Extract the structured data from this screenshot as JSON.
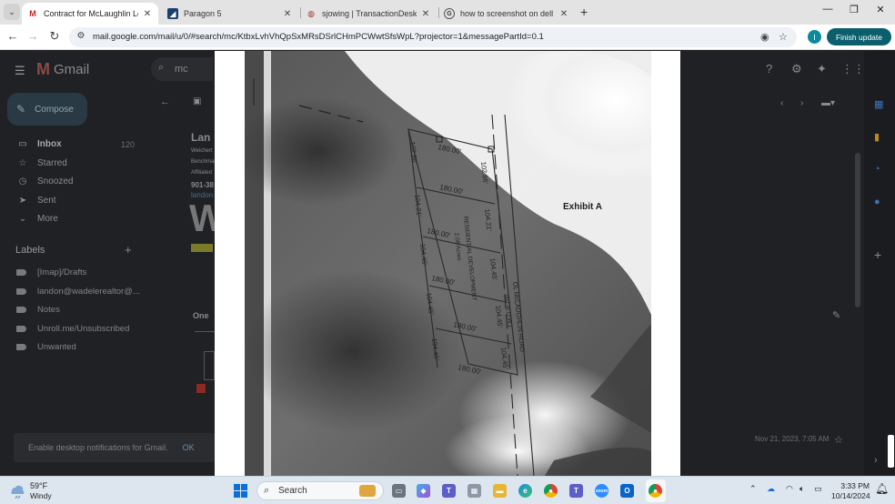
{
  "browser": {
    "tabs": [
      {
        "title": "Contract for McLaughlin Lots -",
        "fav": "M",
        "favColor": "#c5221f"
      },
      {
        "title": "Paragon 5",
        "fav": "◢",
        "favColor": "#1a3e6e"
      },
      {
        "title": "sjowing | TransactionDesk",
        "fav": "◍",
        "favColor": "#9b3a34"
      },
      {
        "title": "how to screenshot on dell lapto",
        "fav": "G",
        "favColor": "#333333"
      }
    ],
    "url": "mail.google.com/mail/u/0/#search/mc/KtbxLvhVhQpSxMRsDSrlCHmPCWwtSfsWpL?projector=1&messagePartId=0.1",
    "profile_initial": "I",
    "update_label": "Finish update"
  },
  "gmail": {
    "logo_text": "Gmail",
    "search_value": "mc",
    "compose_label": "Compose",
    "nav": [
      {
        "label": "Inbox",
        "icon": "▭",
        "count": "120"
      },
      {
        "label": "Starred",
        "icon": "☆"
      },
      {
        "label": "Snoozed",
        "icon": "◷"
      },
      {
        "label": "Sent",
        "icon": "➤"
      },
      {
        "label": "More",
        "icon": "⌄"
      }
    ],
    "labels_heading": "Labels",
    "labels": [
      "[Imap]/Drafts",
      "landon@wadelerealtor@...",
      "Notes",
      "Unroll.me/Unsubscribed",
      "Unwanted"
    ],
    "avatar_initial": "I",
    "fragments": {
      "subject": "Lan",
      "line1": "Weichert",
      "line2": "Benchmark",
      "line3": "Affiliated",
      "phone": "901-38",
      "link": "landon",
      "big": "W",
      "one": "One"
    },
    "date": "Nov 21, 2023, 7:05 AM",
    "notification": "Enable desktop notifications for Gmail.",
    "notification_ok": "OK"
  },
  "document": {
    "exhibit": "Exhibit A",
    "dims": {
      "top": "180.00'",
      "right_top": "102.86'",
      "left_top": "102.86'",
      "d1": "180.00'",
      "d2": "180.00'",
      "d3": "180.00'",
      "d4": "180.00'",
      "d5": "180.00'",
      "l1": "104.21'",
      "l2": "104.45'",
      "l3": "104.45'",
      "l4": "104.45'",
      "r1": "104.21'",
      "r2": "104.45'",
      "r3": "104.45'",
      "r4": "104.45'",
      "zoning": "RESIDENTIAL DEVELOPMENT",
      "area": "2.08 Acres",
      "road": "OL McLAUGHLIN ROAD",
      "row": "(60' R.O.W.)"
    }
  },
  "taskbar": {
    "temp": "59°F",
    "condition": "Windy",
    "search": "Search",
    "time": "3:33 PM",
    "date": "10/14/2024"
  }
}
